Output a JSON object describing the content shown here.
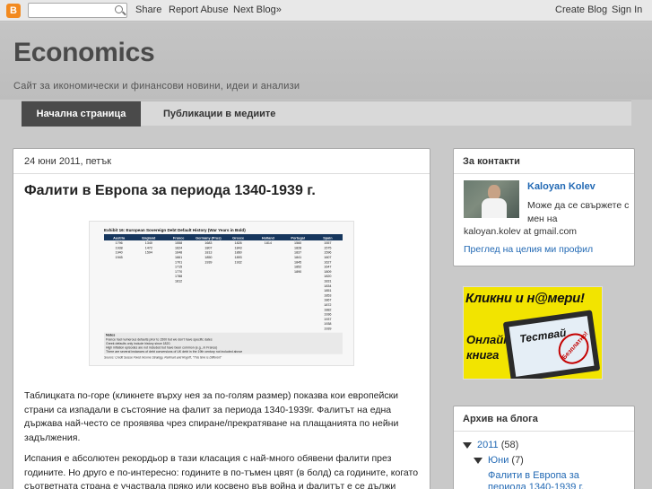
{
  "navbar": {
    "logo": "B",
    "search_placeholder": "",
    "share": "Share",
    "report_abuse": "Report Abuse",
    "next_blog": "Next Blog»",
    "create_blog": "Create Blog",
    "sign_in": "Sign In"
  },
  "header": {
    "title": "Economics",
    "description": "Сайт за икономически и финансови новини, идеи и анализи"
  },
  "tabs": [
    {
      "label": "Начална страница",
      "active": true
    },
    {
      "label": "Публикации в медиите",
      "active": false
    }
  ],
  "post": {
    "date": "24 юни 2011, петък",
    "title": "Фалити в Европа за периода 1340-1939 г.",
    "image": {
      "exhibit": "Exhibit 16: European Sovereign Debt Default History (War Years in Bold)",
      "columns": [
        "Austria",
        "England",
        "France",
        "Germany (Prus)",
        "Greece",
        "Holland",
        "Portugal",
        "Spain"
      ],
      "rows": [
        [
          "1796",
          "1340",
          "1558",
          "1683",
          "1826",
          "1814",
          "1560",
          "1557"
        ],
        [
          "1938",
          "1472",
          "1624",
          "1807",
          "1843",
          "",
          "1828",
          "1575"
        ],
        [
          "1940",
          "1594",
          "1648",
          "1813",
          "1860",
          "",
          "1837",
          "1596"
        ],
        [
          "1945",
          "",
          "1661",
          "1850",
          "1893",
          "",
          "1841",
          "1607"
        ],
        [
          "",
          "",
          "1701",
          "1939",
          "1932",
          "",
          "1845",
          "1627"
        ],
        [
          "",
          "",
          "1715",
          "",
          "",
          "",
          "1852",
          "1647"
        ],
        [
          "",
          "",
          "1770",
          "",
          "",
          "",
          "1890",
          "1809"
        ],
        [
          "",
          "",
          "1788",
          "",
          "",
          "",
          "",
          "1820"
        ],
        [
          "",
          "",
          "1812",
          "",
          "",
          "",
          "",
          "1831"
        ],
        [
          "",
          "",
          "",
          "",
          "",
          "",
          "",
          "1834"
        ],
        [
          "",
          "",
          "",
          "",
          "",
          "",
          "",
          "1851"
        ],
        [
          "",
          "",
          "",
          "",
          "",
          "",
          "",
          "1853"
        ],
        [
          "",
          "",
          "",
          "",
          "",
          "",
          "",
          "1867"
        ],
        [
          "",
          "",
          "",
          "",
          "",
          "",
          "",
          "1872"
        ],
        [
          "",
          "",
          "",
          "",
          "",
          "",
          "",
          "1882"
        ],
        [
          "",
          "",
          "",
          "",
          "",
          "",
          "",
          "1936"
        ],
        [
          "",
          "",
          "",
          "",
          "",
          "",
          "",
          "1937"
        ],
        [
          "",
          "",
          "",
          "",
          "",
          "",
          "",
          "1938"
        ],
        [
          "",
          "",
          "",
          "",
          "",
          "",
          "",
          "1939"
        ]
      ],
      "notes_title": "Notes",
      "notes": [
        "France had numerous defaults prior to 1500 but we don't have specific dates",
        "Greek defaults only include history since 1820.",
        "High inflation episodes are not included but have been common (e.g., in France)",
        "There are several instances of debt conversions of UK debt in the 19th century not included above"
      ],
      "source": "Source: Credit Suisse Fixed Income Strategy, Reinhart and Rogoff, \"This time is Different\""
    },
    "paragraph1": "Таблицката по-горе (кликнете върху нея за по-голям размер) показва кои европейски страни са изпадали в състояние на фалит за периода 1340-1939г. Фалитът на една държава най-често се проявява чрез спиране/прекратяване на плащанията по нейни задължения.",
    "paragraph2": "Испания е абсолютен рекордьор в тази класация с най-много обявени фалити през годините. Но друго е по-интересно: годините в по-тъмен цвят (в болд) са годините, когато съответната страна е участвала пряко или косвено във война и фалитът е се дължи"
  },
  "sidebar": {
    "contacts": {
      "heading": "За контакти",
      "name": "Kaloyan Kolev",
      "text": "Може да се свържете с мен на",
      "email": "kaloyan.kolev at gmail.com",
      "profile_link": "Преглед на целия ми профил"
    },
    "ad": {
      "line1": "Кликни и н@мери!",
      "line2": "Онлайн",
      "line3": "книга",
      "tablet_label": "Тествай",
      "stamp": "Безплатно!"
    },
    "archive": {
      "heading": "Архив на блога",
      "year": "2011",
      "year_count": "(58)",
      "month": "Юни",
      "month_count": "(7)",
      "post_line1": "Фалити в Европа за",
      "post_line2": "периода 1340-1939 г."
    }
  },
  "colors": {
    "background": "#c9c9c9",
    "link": "#2269b4",
    "active_tab": "#4a4a4a",
    "blogger_orange": "#f28a20"
  }
}
